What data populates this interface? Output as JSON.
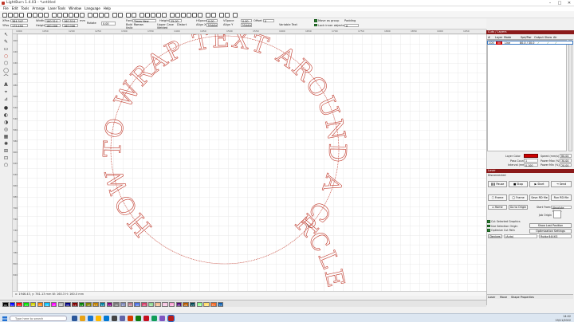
{
  "window": {
    "title": "LightBurn 1.4.03 - *untitled",
    "controls": [
      "–",
      "□",
      "✕"
    ]
  },
  "menu": [
    "File",
    "Edit",
    "Tools",
    "Arrange",
    "Laser Tools",
    "Window",
    "Language",
    "Help"
  ],
  "toolbar2": {
    "xpos_label": "XPos",
    "xpos": "384.347",
    "ypos_label": "YPos",
    "ypos": "175.450",
    "width_label": "Width",
    "width": "160.314",
    "height_label": "Height",
    "height": "160.006",
    "units": "mm",
    "rotate_label": "Rotate",
    "rotate": "0.00",
    "font_label": "Font",
    "font": "Times New Roman",
    "height2_label": "Height",
    "height2": "25.00",
    "hspace_label": "HSpace",
    "hspace": "0.00",
    "vspace_label": "VSpace",
    "vspace": "0.00",
    "align_x_label": "Align X",
    "align_x": "Middle",
    "align_y_label": "Align Y",
    "align_y": "Middle",
    "offset_label": "Offset",
    "offset": "0",
    "bold_label": "Bold",
    "italic_label": "Italic",
    "upper_label": "Upper Case",
    "welded_label": "Welded",
    "distort_label": "Distort",
    "variable_label": "Variable Text",
    "move_group": "Move as group",
    "lock_inner": "Lock inner objects",
    "padding_label": "Padding",
    "padding": "0"
  },
  "ruler_top": [
    "1900",
    "1950",
    "1200",
    "1250",
    "1300",
    "1350",
    "1400",
    "1450",
    "1500",
    "1550",
    "1600",
    "1650",
    "1700",
    "1750",
    "1800",
    "1850",
    "1900",
    "1950"
  ],
  "ruler_left": [
    "400",
    "420",
    "440",
    "460",
    "480",
    "500",
    "520",
    "540",
    "560",
    "580",
    "600",
    "620",
    "640",
    "660",
    "680",
    "700",
    "720",
    "740",
    "760",
    "780",
    "800",
    "820"
  ],
  "canvas_text": "HOW TO WRAP TEXT AROUND A CIRCLE",
  "status": "x: 1946.43, y: 761.13 mm  W: 160.3  H: 160.0 mm",
  "palette": [
    "00",
    "01",
    "02",
    "03",
    "04",
    "05",
    "06",
    "07",
    "08",
    "09",
    "10",
    "11",
    "12",
    "13",
    "14",
    "15",
    "16",
    "17",
    "18",
    "19",
    "20",
    "21",
    "22",
    "23",
    "24",
    "25",
    "26",
    "27",
    "28",
    "29",
    "T1",
    "T2"
  ],
  "palette_colors": [
    "#000000",
    "#0000ff",
    "#ff0000",
    "#00e000",
    "#d0d000",
    "#ff8000",
    "#00c0ff",
    "#ff00ff",
    "#b4b4b4",
    "#000080",
    "#800000",
    "#008000",
    "#808000",
    "#c08000",
    "#0080a0",
    "#800080",
    "#7a7a7a",
    "#7d87b9",
    "#bb7784",
    "#4a6fe3",
    "#d33f6a",
    "#8cd78e",
    "#f0b98d",
    "#f6c4e1",
    "#fa9ed4",
    "#500a78",
    "#b45a00",
    "#004754",
    "#86fa88",
    "#ffdb66",
    "#f36926",
    "#0c5eaf"
  ],
  "cuts": {
    "title": "Cuts / Layers",
    "headers": [
      "#",
      "Layer",
      "Mode",
      "Spd/Pwr",
      "Output",
      "Show",
      "Air"
    ],
    "row": {
      "num": "C00",
      "layer": "00",
      "mode": "Line",
      "spdpwr": "80.0 / 30.0",
      "output": "✓",
      "show": "✓",
      "air": "✓"
    },
    "layer_color_label": "Layer Color",
    "speed_label": "Speed (mm/s)",
    "speed": "80.00",
    "pass_label": "Pass Count",
    "pass": "1",
    "pmax_label": "Power Max (%)",
    "pmax": "30.00",
    "interval_label": "Interval (mm)",
    "interval": "0.100",
    "pmin_label": "Power Min (%)",
    "pmin": "20.00"
  },
  "laser": {
    "title": "Laser",
    "status": "Disconnected",
    "pause": "Pause",
    "stop": "Stop",
    "start": "Start",
    "send": "Send",
    "frame": "Frame",
    "frame2": "Frame",
    "save_rd": "Save RD file",
    "run_rd": "Run RD file",
    "home": "Home",
    "go_origin": "Go to Origin",
    "start_from": "Start From:",
    "start_from_val": "Absolute Coords",
    "job_origin": "Job Origin",
    "cut_selected": "Cut Selected Graphics",
    "use_selection_origin": "Use Selection Origin",
    "optimize": "Optimize Cut Path",
    "show_last": "Show Last Position",
    "opt_settings": "Optimization Settings",
    "devices_label": "Devices",
    "devices_val": "(Auto)",
    "device_name": "Ruida 644XG"
  },
  "bottom_tabs": [
    "Laser",
    "Move",
    "Shape Properties"
  ],
  "taskbar": {
    "search": "Type here to search",
    "time": "14:02",
    "date": "19/11/2022"
  }
}
